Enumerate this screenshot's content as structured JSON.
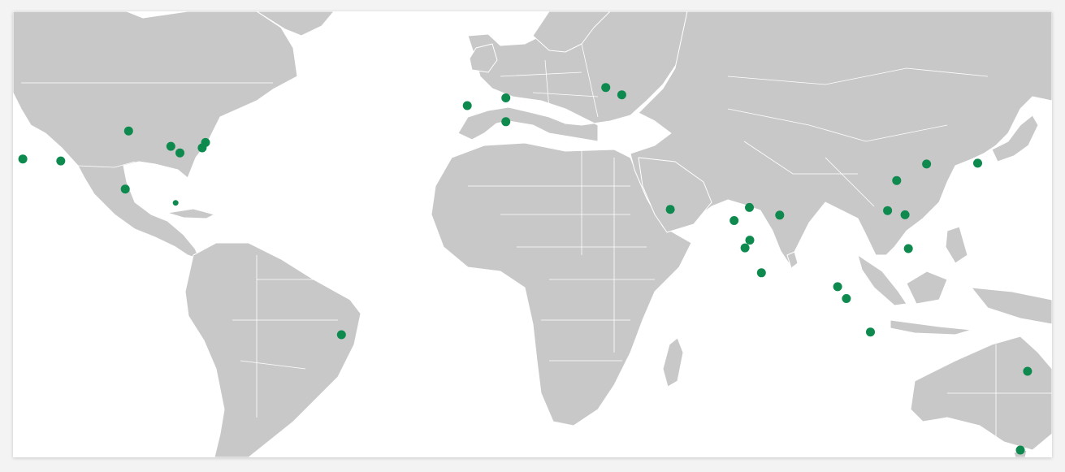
{
  "map": {
    "projection": "equirectangular",
    "land_color": "#c8c8c8",
    "border_color": "#ffffff",
    "background_color": "#ffffff",
    "view": {
      "lon": [
        -125,
        160
      ],
      "lat": [
        -40,
        76
      ]
    },
    "marker_color": "#0e8a4f",
    "markers": [
      {
        "lon": -122.3,
        "lat": 37.6
      },
      {
        "lon": -111.9,
        "lat": 37.1
      },
      {
        "lon": -93.3,
        "lat": 44.9
      },
      {
        "lon": -94.2,
        "lat": 29.8
      },
      {
        "lon": -81.7,
        "lat": 40.9
      },
      {
        "lon": -79.2,
        "lat": 39.2
      },
      {
        "lon": -72.2,
        "lat": 41.9
      },
      {
        "lon": -73.1,
        "lat": 40.5
      },
      {
        "lon": -80.4,
        "lat": 26.2,
        "small": true
      },
      {
        "lon": -34.9,
        "lat": -8.1
      },
      {
        "lon": -0.4,
        "lat": 51.5
      },
      {
        "lon": 10.2,
        "lat": 53.5
      },
      {
        "lon": 10.2,
        "lat": 47.3
      },
      {
        "lon": 37.6,
        "lat": 56.2
      },
      {
        "lon": 42.0,
        "lat": 54.3
      },
      {
        "lon": 55.3,
        "lat": 24.5
      },
      {
        "lon": 72.8,
        "lat": 21.6
      },
      {
        "lon": 77.0,
        "lat": 25.0
      },
      {
        "lon": 85.3,
        "lat": 23.0
      },
      {
        "lon": 77.1,
        "lat": 16.5
      },
      {
        "lon": 75.8,
        "lat": 14.5
      },
      {
        "lon": 80.3,
        "lat": 8.0
      },
      {
        "lon": 101.2,
        "lat": 4.4
      },
      {
        "lon": 103.6,
        "lat": 1.3
      },
      {
        "lon": 110.2,
        "lat": -7.4
      },
      {
        "lon": 117.4,
        "lat": 32.0
      },
      {
        "lon": 125.6,
        "lat": 36.3
      },
      {
        "lon": 139.6,
        "lat": 36.5
      },
      {
        "lon": 114.9,
        "lat": 24.2
      },
      {
        "lon": 119.7,
        "lat": 23.1
      },
      {
        "lon": 120.6,
        "lat": 14.3
      },
      {
        "lon": 153.3,
        "lat": -17.6
      },
      {
        "lon": 151.3,
        "lat": -38.1
      }
    ]
  }
}
